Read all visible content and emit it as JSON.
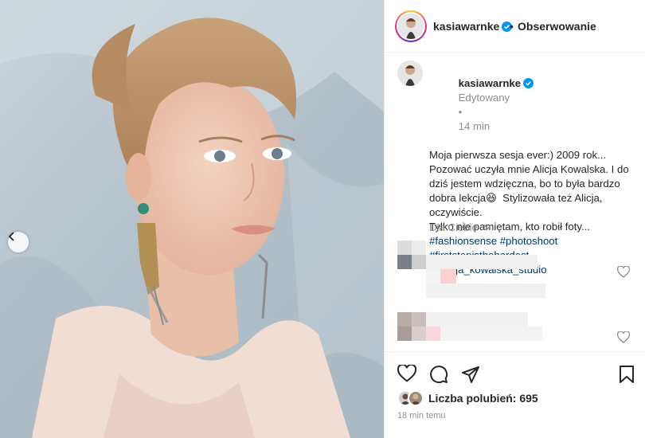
{
  "header": {
    "username": "kasiawarnke",
    "separator": "•",
    "follow_label": "Obserwowanie"
  },
  "caption": {
    "username": "kasiawarnke",
    "edited": "Edytowany",
    "dot": "•",
    "time": "14 min",
    "lines": [
      "Moja pierwsza sesja ever:) 2009 rok...",
      "Pozować uczyła mnie Alicja Kowalska. I do",
      "dziś jestem wdzięczna, bo to była bardzo",
      "dobra lekcja😆  Stylizowała też Alicja,",
      "oczywiście.",
      "Tylko nie pamiętam, kto robił foty..."
    ],
    "tags": [
      "#fashionsense #photoshoot",
      "#firststepisthehardest",
      "@alicja_kowalska_studio"
    ],
    "for_you_label": "Dla Ciebie"
  },
  "likes": {
    "label": "Liczba polubień: ",
    "count": "695"
  },
  "timestamp": "18 min temu",
  "icons": {
    "verified": "verified-badge-icon",
    "carousel_prev": "chevron-left-icon",
    "like": "heart-icon",
    "comment": "comment-icon",
    "share": "send-icon",
    "save": "bookmark-icon"
  },
  "colors": {
    "verified": "#0095f6",
    "tag": "#00376b",
    "muted": "#8e8e8e",
    "text": "#262626"
  }
}
